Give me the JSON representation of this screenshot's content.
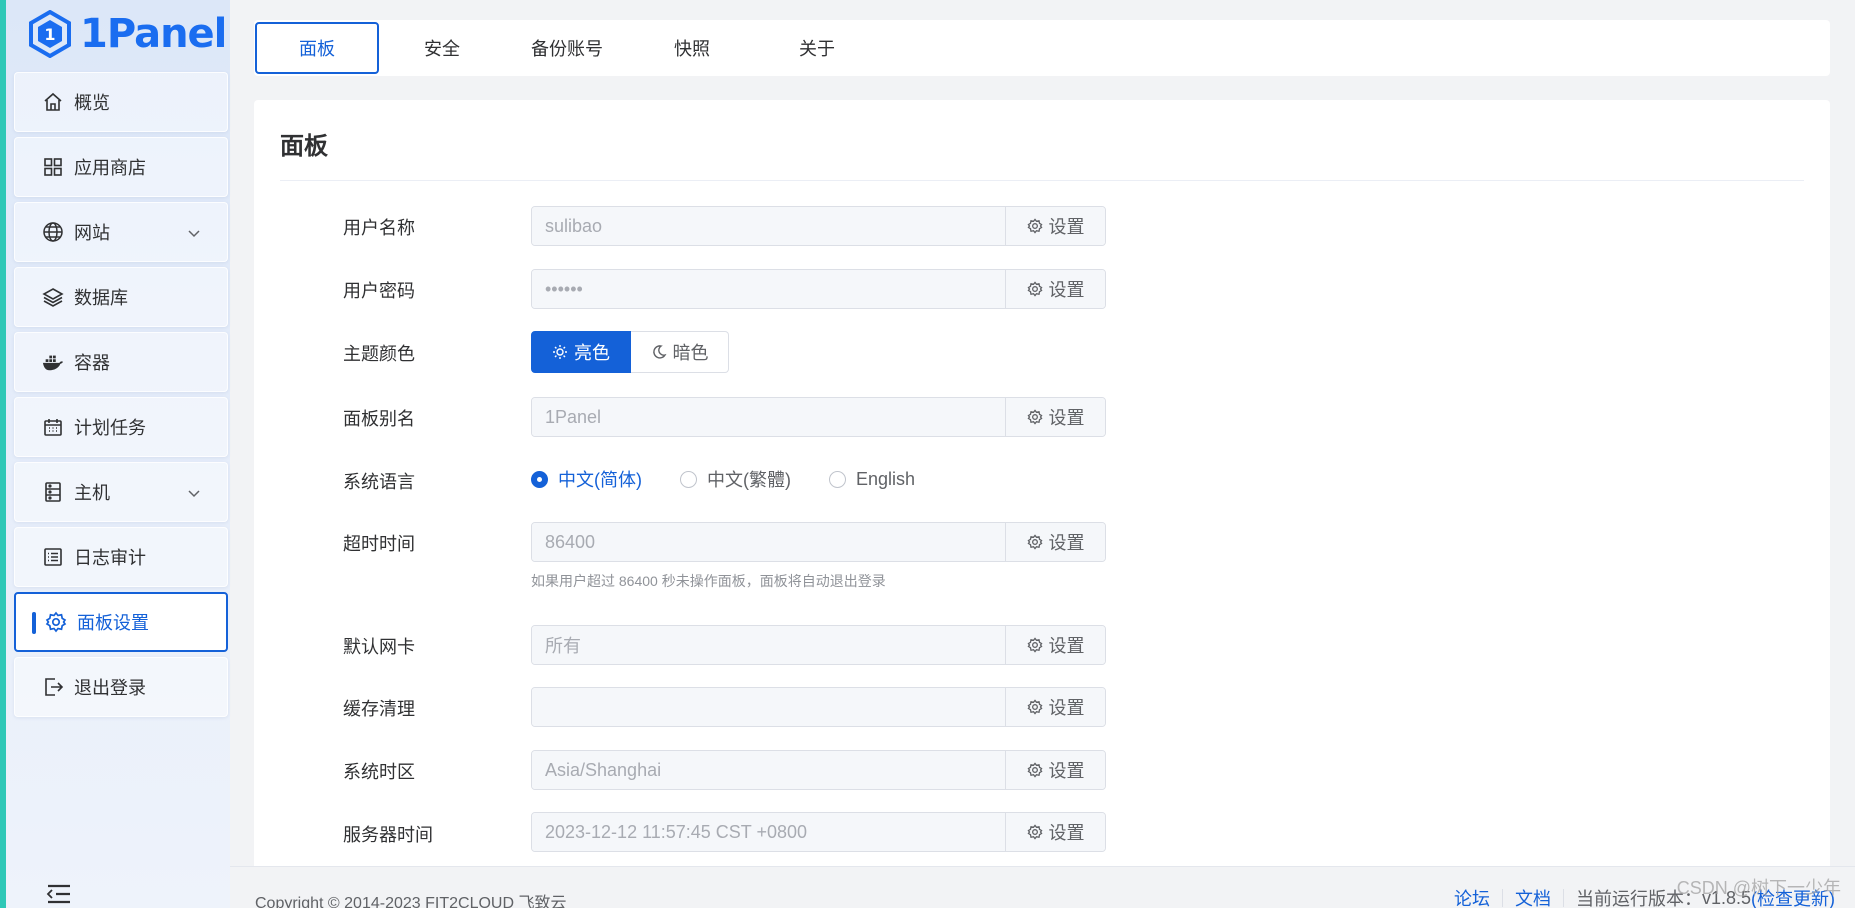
{
  "app": {
    "logo_text": "1Panel"
  },
  "sidebar": {
    "items": [
      {
        "label": "概览",
        "icon": "home-icon"
      },
      {
        "label": "应用商店",
        "icon": "grid-icon"
      },
      {
        "label": "网站",
        "icon": "globe-icon",
        "expandable": true
      },
      {
        "label": "数据库",
        "icon": "layers-icon"
      },
      {
        "label": "容器",
        "icon": "docker-icon"
      },
      {
        "label": "计划任务",
        "icon": "calendar-icon"
      },
      {
        "label": "主机",
        "icon": "server-icon",
        "expandable": true
      },
      {
        "label": "日志审计",
        "icon": "log-icon"
      },
      {
        "label": "面板设置",
        "icon": "gear-icon",
        "active": true
      },
      {
        "label": "退出登录",
        "icon": "logout-icon"
      }
    ]
  },
  "tabs": [
    {
      "label": "面板",
      "active": true
    },
    {
      "label": "安全"
    },
    {
      "label": "备份账号"
    },
    {
      "label": "快照"
    },
    {
      "label": "关于"
    }
  ],
  "panel": {
    "title": "面板",
    "set_label": "设置",
    "fields": {
      "username": {
        "label": "用户名称",
        "value": "sulibao"
      },
      "password": {
        "label": "用户密码",
        "value": "••••••"
      },
      "theme": {
        "label": "主题颜色",
        "light": "亮色",
        "dark": "暗色",
        "selected": "light"
      },
      "alias": {
        "label": "面板别名",
        "value": "1Panel"
      },
      "language": {
        "label": "系统语言",
        "options": [
          "中文(简体)",
          "中文(繁體)",
          "English"
        ],
        "selected": "中文(简体)"
      },
      "timeout": {
        "label": "超时时间",
        "value": "86400",
        "hint": "如果用户超过 86400 秒未操作面板，面板将自动退出登录"
      },
      "nic": {
        "label": "默认网卡",
        "value": "所有"
      },
      "cache": {
        "label": "缓存清理",
        "value": ""
      },
      "timezone": {
        "label": "系统时区",
        "value": "Asia/Shanghai"
      },
      "server_time": {
        "label": "服务器时间",
        "value": "2023-12-12 11:57:45 CST +0800"
      }
    }
  },
  "footer": {
    "copyright": "Copyright © 2014-2023 FIT2CLOUD 飞致云",
    "forum": "论坛",
    "docs": "文档",
    "version_label": "当前运行版本：",
    "version": "v1.8.5",
    "check_update": "(检查更新)"
  },
  "watermark": "CSDN @树下一少年",
  "colors": {
    "primary": "#1461d8",
    "accent_strip": "#2fc8b7"
  }
}
